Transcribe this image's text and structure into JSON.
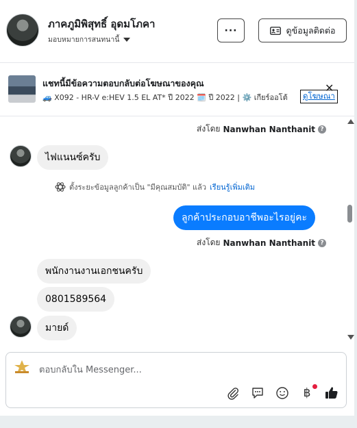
{
  "header": {
    "name": "ภาคภูมิพิสุทธิ์ อุดมโภคา",
    "assign_label": "มอบหมายการสนทนานี้",
    "more_label": "···",
    "contact_label": "ดูข้อมูลติดต่อ"
  },
  "ad": {
    "title": "แชทนี้มีข้อความตอบกลับต่อโฆษณาของคุณ",
    "subtitle": "🚙 X092 - HR-V e:HEV 1.5 EL AT* ปี 2022 🗓️ ปี 2022 | ⚙️ เกียร์ออโต้",
    "link_label": "ดูโฆษณา",
    "close_label": "✕"
  },
  "messages": {
    "sent_by_prefix": "ส่งโดย",
    "agent_name": "Nanwhan Nanthanit",
    "incoming_1": "ไฟแนนซ์ครับ",
    "system_text": "ตั้งระยะข้อมูลลูกค้าเป็น \"มีคุณสมบัติ\" แล้ว",
    "system_link": "เรียนรู้เพิ่มเติม",
    "outgoing_1": "ลูกค้าประกอบอาชีพอะไรอยู่คะ",
    "incoming_2": "พนักงานงานเอกชนครับ",
    "incoming_3": "0801589564",
    "incoming_4": "มายด์"
  },
  "composer": {
    "placeholder": "ตอบกลับใน Messenger..."
  },
  "colors": {
    "accent": "#0a7cff",
    "link": "#0064d1",
    "incoming_bubble": "#f0f0f0"
  },
  "icons": [
    "contact-card-icon",
    "close-icon",
    "info-icon",
    "atom-icon",
    "attach-icon",
    "chat-bubble-icon",
    "emoji-icon",
    "baht-icon",
    "thumbs-up-icon"
  ]
}
